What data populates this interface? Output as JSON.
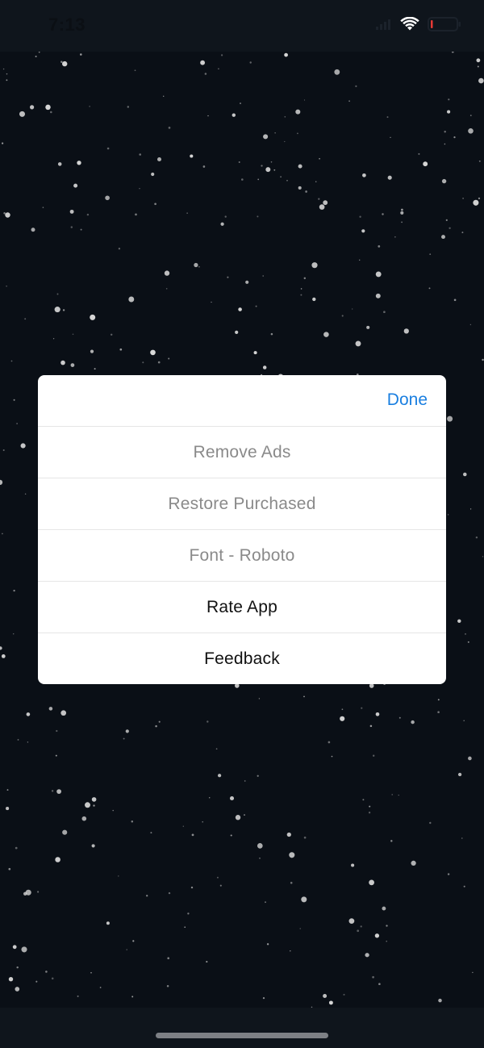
{
  "status_bar": {
    "time": "7:13",
    "icons": [
      "signal-icon",
      "wifi-icon",
      "battery-icon"
    ],
    "battery_color": "#e53935"
  },
  "dialog": {
    "done_label": "Done",
    "done_color": "#1a7fe0",
    "items": [
      {
        "label": "Remove Ads",
        "enabled": false
      },
      {
        "label": "Restore Purchased",
        "enabled": false
      },
      {
        "label": "Font - Roboto",
        "enabled": false
      },
      {
        "label": "Rate App",
        "enabled": true
      },
      {
        "label": "Feedback",
        "enabled": true
      }
    ]
  },
  "background": {
    "type": "starfield",
    "color": "#0a0f16",
    "star_color": "#d8d8d8"
  }
}
